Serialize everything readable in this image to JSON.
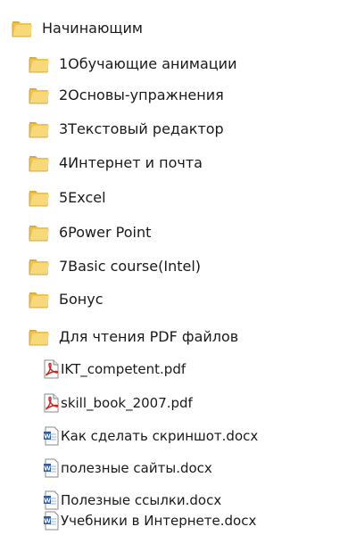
{
  "tree": {
    "root": {
      "label": "Начинающим",
      "icon": "folder-icon"
    },
    "folders": [
      {
        "label": "1Обучающие анимации",
        "icon": "folder-icon"
      },
      {
        "label": "2Основы-упражнения",
        "icon": "folder-icon"
      },
      {
        "label": "3Текстовый редактор",
        "icon": "folder-icon"
      },
      {
        "label": "4Интернет и почта",
        "icon": "folder-icon"
      },
      {
        "label": "5Excel",
        "icon": "folder-icon"
      },
      {
        "label": "6Power Point",
        "icon": "folder-icon"
      },
      {
        "label": "7Basic course(Intel)",
        "icon": "folder-icon"
      },
      {
        "label": "Бонус",
        "icon": "folder-icon"
      },
      {
        "label": "Для чтения PDF файлов",
        "icon": "folder-icon"
      }
    ],
    "files": [
      {
        "label": "IKT_competent.pdf",
        "icon": "pdf-file-icon"
      },
      {
        "label": "skill_book_2007.pdf",
        "icon": "pdf-file-icon"
      },
      {
        "label": "Как сделать скриншот.docx",
        "icon": "word-file-icon"
      },
      {
        "label": "полезные сайты.docx",
        "icon": "word-file-icon"
      },
      {
        "label": "Полезные ссылки.docx",
        "icon": "word-file-icon"
      },
      {
        "label": "Учебники в Интернете.docx",
        "icon": "word-file-icon"
      }
    ]
  },
  "colors": {
    "folder_body": "#f0c44c",
    "folder_front": "#f7d97a",
    "pdf_red": "#d0201a",
    "word_blue": "#2a5caa"
  }
}
